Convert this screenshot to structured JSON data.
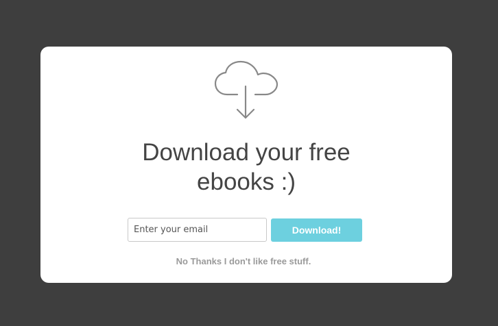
{
  "modal": {
    "icon": "cloud-download-icon",
    "headline": "Download your free ebooks :)",
    "email_placeholder": "Enter your email",
    "email_value": "",
    "download_label": "Download!",
    "dismiss_label": "No Thanks I don't like free stuff."
  },
  "colors": {
    "backdrop": "#3e3e3e",
    "panel": "#ffffff",
    "button": "#6dd0df",
    "icon": "#888888",
    "headline": "#444444",
    "dismiss": "#9a9a9a"
  }
}
